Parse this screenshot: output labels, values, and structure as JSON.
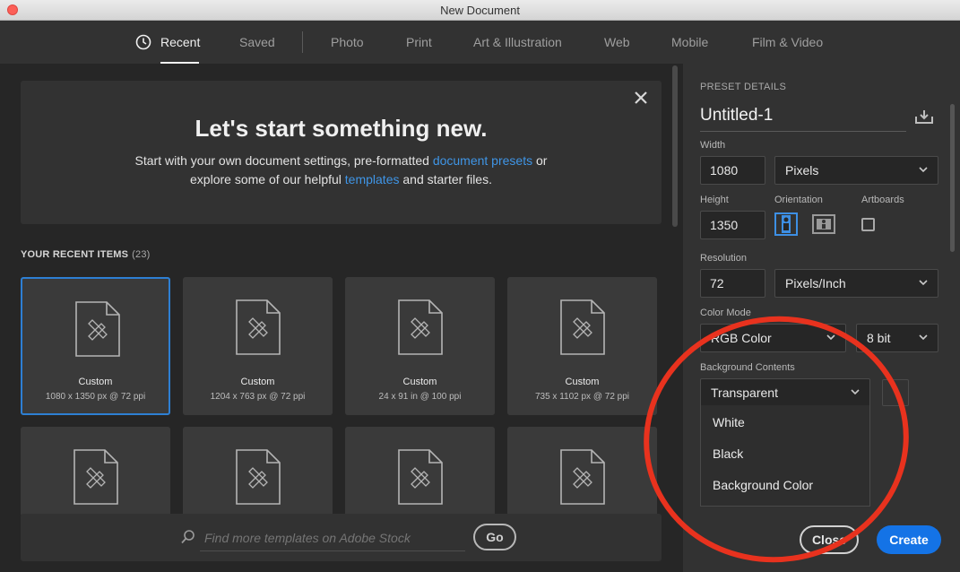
{
  "window": {
    "title": "New Document"
  },
  "tabs": [
    {
      "label": "Recent"
    },
    {
      "label": "Saved"
    },
    {
      "label": "Photo"
    },
    {
      "label": "Print"
    },
    {
      "label": "Art & Illustration"
    },
    {
      "label": "Web"
    },
    {
      "label": "Mobile"
    },
    {
      "label": "Film & Video"
    }
  ],
  "hero": {
    "heading": "Let's start something new.",
    "line1_pre": "Start with your own document settings, pre-formatted ",
    "line1_link": "document presets",
    "line1_post": " or",
    "line2_pre": "explore some of our helpful ",
    "line2_link": "templates",
    "line2_post": " and starter files."
  },
  "recent": {
    "title": "YOUR RECENT ITEMS",
    "count": "(23)",
    "items": [
      {
        "name": "Custom",
        "meta": "1080 x 1350 px @ 72 ppi"
      },
      {
        "name": "Custom",
        "meta": "1204 x 763 px @ 72 ppi"
      },
      {
        "name": "Custom",
        "meta": "24 x 91 in @ 100 ppi"
      },
      {
        "name": "Custom",
        "meta": "735 x 1102 px @ 72 ppi"
      }
    ]
  },
  "stock": {
    "placeholder": "Find more templates on Adobe Stock",
    "go_label": "Go"
  },
  "preset": {
    "section_title": "PRESET DETAILS",
    "doc_name": "Untitled-1",
    "width_label": "Width",
    "width_value": "1080",
    "width_unit": "Pixels",
    "height_label": "Height",
    "height_value": "1350",
    "orientation_label": "Orientation",
    "artboards_label": "Artboards",
    "resolution_label": "Resolution",
    "resolution_value": "72",
    "resolution_unit": "Pixels/Inch",
    "color_mode_label": "Color Mode",
    "color_mode_value": "RGB Color",
    "bit_depth_value": "8 bit",
    "bg_label": "Background Contents",
    "bg_value": "Transparent",
    "bg_options": [
      "White",
      "Black",
      "Background Color"
    ]
  },
  "actions": {
    "close_label": "Close",
    "create_label": "Create"
  },
  "colors": {
    "accent": "#1473e6",
    "link": "#3f95e6",
    "annotation": "#e8321e"
  }
}
